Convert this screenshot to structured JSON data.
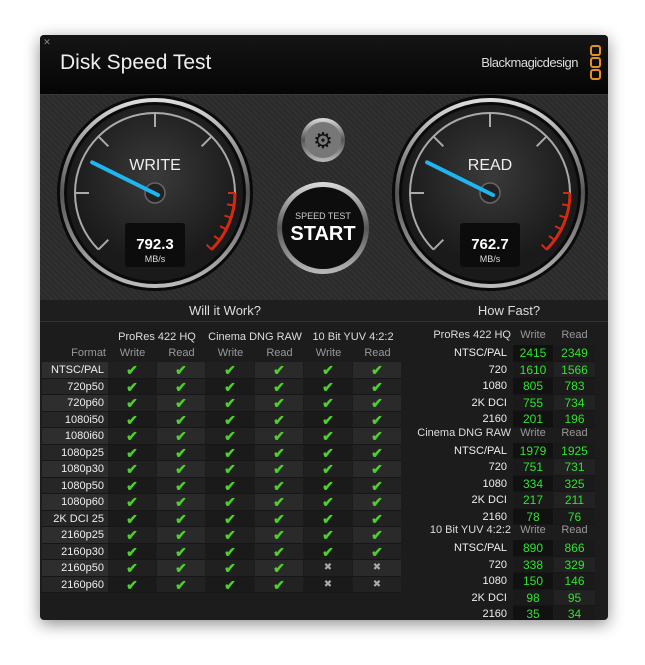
{
  "app": {
    "title": "Disk Speed Test",
    "brand": "Blackmagicdesign",
    "close_icon": "close-icon"
  },
  "colors": {
    "accent": "#e39022",
    "needle": "#1fb5f0",
    "check": "#4fcf2a",
    "number": "#2fe22f",
    "redzone": "#d42a10"
  },
  "gauges": {
    "write": {
      "label": "WRITE",
      "value": "792.3",
      "unit": "MB/s"
    },
    "read": {
      "label": "READ",
      "value": "762.7",
      "unit": "MB/s"
    }
  },
  "start_button": {
    "top": "SPEED TEST",
    "main": "START"
  },
  "settings_icon": "gear-icon",
  "will_it_work": {
    "title": "Will it Work?",
    "format_label": "Format",
    "groups": [
      "ProRes 422 HQ",
      "Cinema DNG RAW",
      "10 Bit YUV 4:2:2"
    ],
    "subcols": [
      "Write",
      "Read",
      "Write",
      "Read",
      "Write",
      "Read"
    ],
    "rows": [
      {
        "format": "NTSC/PAL",
        "ok": [
          1,
          1,
          1,
          1,
          1,
          1
        ]
      },
      {
        "format": "720p50",
        "ok": [
          1,
          1,
          1,
          1,
          1,
          1
        ]
      },
      {
        "format": "720p60",
        "ok": [
          1,
          1,
          1,
          1,
          1,
          1
        ]
      },
      {
        "format": "1080i50",
        "ok": [
          1,
          1,
          1,
          1,
          1,
          1
        ]
      },
      {
        "format": "1080i60",
        "ok": [
          1,
          1,
          1,
          1,
          1,
          1
        ]
      },
      {
        "format": "1080p25",
        "ok": [
          1,
          1,
          1,
          1,
          1,
          1
        ]
      },
      {
        "format": "1080p30",
        "ok": [
          1,
          1,
          1,
          1,
          1,
          1
        ]
      },
      {
        "format": "1080p50",
        "ok": [
          1,
          1,
          1,
          1,
          1,
          1
        ]
      },
      {
        "format": "1080p60",
        "ok": [
          1,
          1,
          1,
          1,
          1,
          1
        ]
      },
      {
        "format": "2K DCI 25",
        "ok": [
          1,
          1,
          1,
          1,
          1,
          1
        ]
      },
      {
        "format": "2160p25",
        "ok": [
          1,
          1,
          1,
          1,
          1,
          1
        ]
      },
      {
        "format": "2160p30",
        "ok": [
          1,
          1,
          1,
          1,
          1,
          1
        ]
      },
      {
        "format": "2160p50",
        "ok": [
          1,
          1,
          1,
          1,
          0,
          0
        ]
      },
      {
        "format": "2160p60",
        "ok": [
          1,
          1,
          1,
          1,
          0,
          0
        ]
      }
    ]
  },
  "how_fast": {
    "title": "How Fast?",
    "groups": [
      {
        "name": "ProRes 422 HQ",
        "write": "Write",
        "read": "Read",
        "rows": [
          {
            "format": "NTSC/PAL",
            "write": "2415",
            "read": "2349"
          },
          {
            "format": "720",
            "write": "1610",
            "read": "1566"
          },
          {
            "format": "1080",
            "write": "805",
            "read": "783"
          },
          {
            "format": "2K DCI",
            "write": "755",
            "read": "734"
          },
          {
            "format": "2160",
            "write": "201",
            "read": "196"
          }
        ]
      },
      {
        "name": "Cinema DNG RAW",
        "write": "Write",
        "read": "Read",
        "rows": [
          {
            "format": "NTSC/PAL",
            "write": "1979",
            "read": "1925"
          },
          {
            "format": "720",
            "write": "751",
            "read": "731"
          },
          {
            "format": "1080",
            "write": "334",
            "read": "325"
          },
          {
            "format": "2K DCI",
            "write": "217",
            "read": "211"
          },
          {
            "format": "2160",
            "write": "78",
            "read": "76"
          }
        ]
      },
      {
        "name": "10 Bit YUV 4:2:2",
        "write": "Write",
        "read": "Read",
        "rows": [
          {
            "format": "NTSC/PAL",
            "write": "890",
            "read": "866"
          },
          {
            "format": "720",
            "write": "338",
            "read": "329"
          },
          {
            "format": "1080",
            "write": "150",
            "read": "146"
          },
          {
            "format": "2K DCI",
            "write": "98",
            "read": "95"
          },
          {
            "format": "2160",
            "write": "35",
            "read": "34"
          }
        ]
      }
    ]
  }
}
